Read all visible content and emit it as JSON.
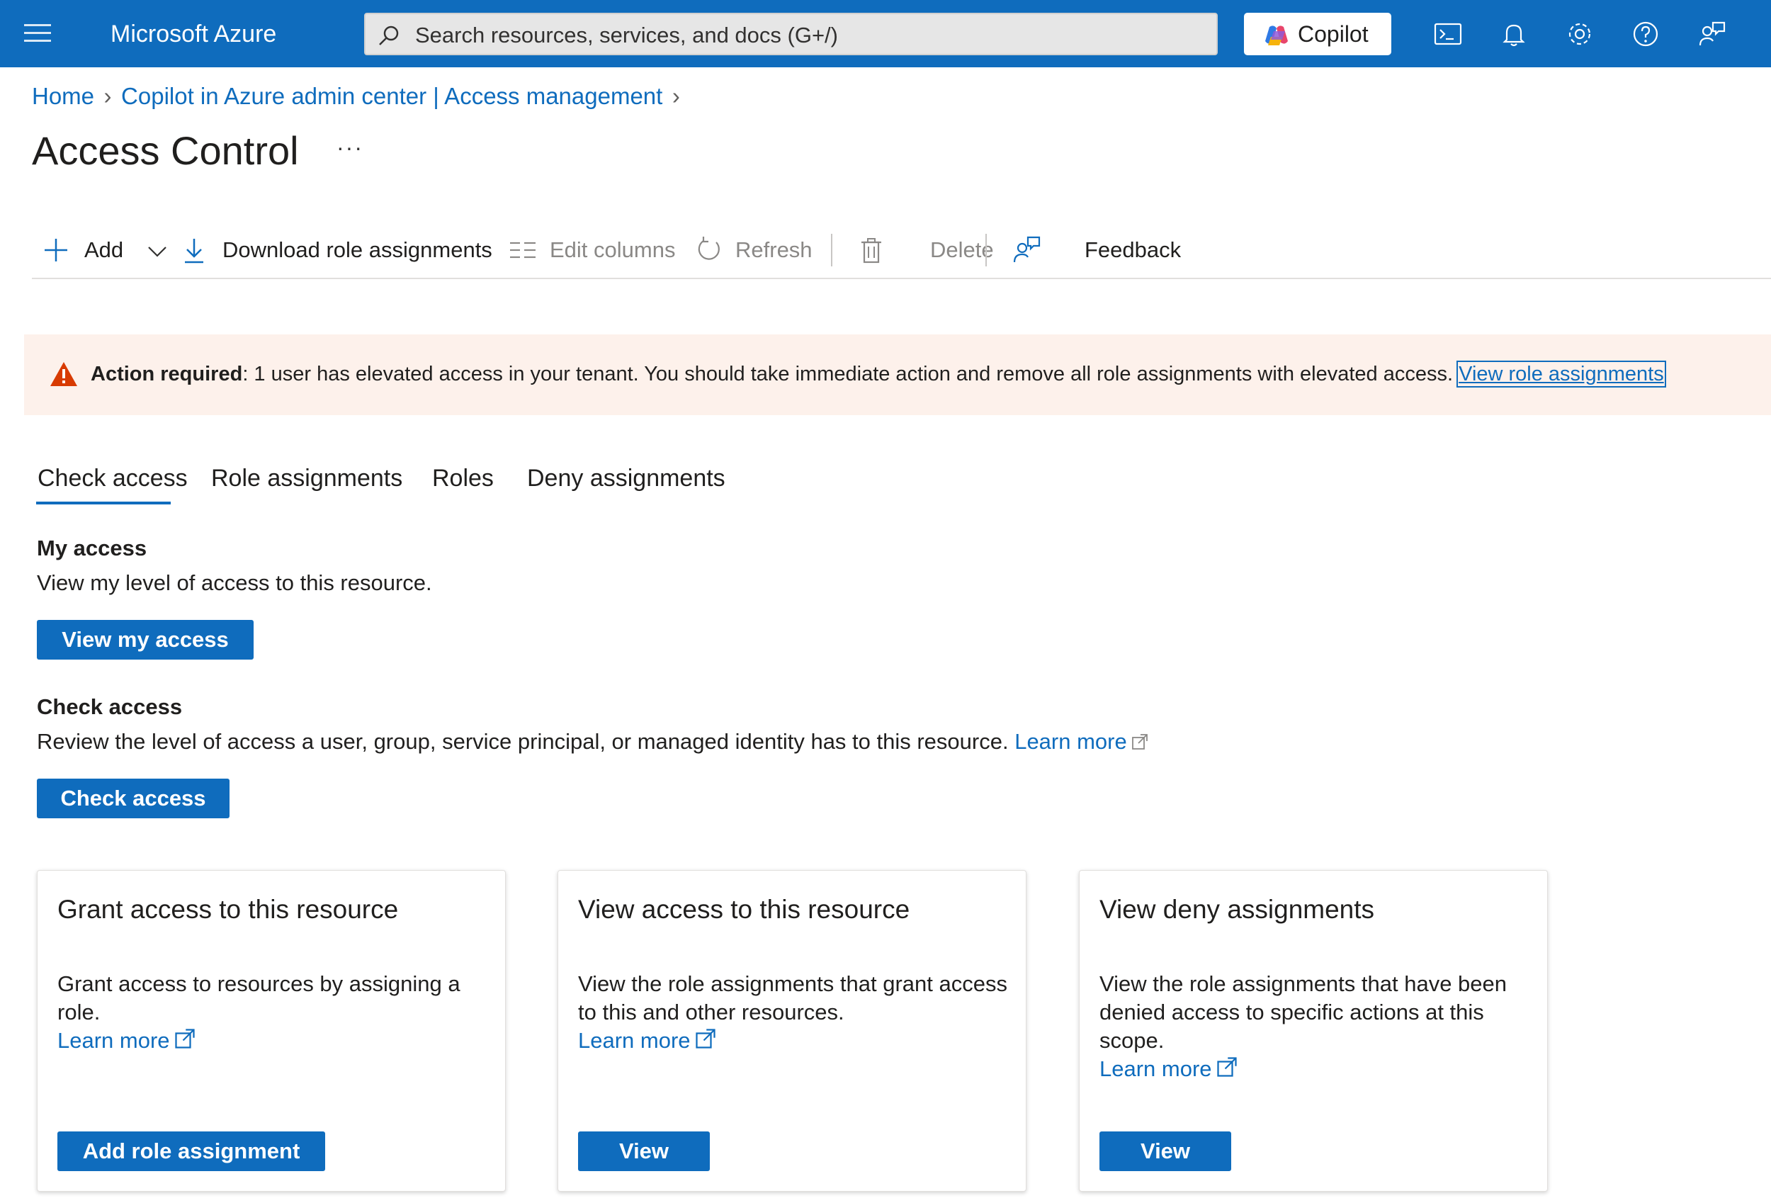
{
  "topbar": {
    "brand": "Microsoft Azure",
    "search_placeholder": "Search resources, services, and docs (G+/)",
    "copilot_label": "Copilot",
    "icons": [
      "cloud-shell-icon",
      "notifications-icon",
      "settings-icon",
      "help-icon",
      "feedback-icon"
    ]
  },
  "breadcrumb": {
    "home": "Home",
    "parent": "Copilot in Azure admin center | Access management"
  },
  "page": {
    "title": "Access Control",
    "more": "···"
  },
  "commands": {
    "add": "Add",
    "download": "Download role assignments",
    "edit_columns": "Edit columns",
    "refresh": "Refresh",
    "delete": "Delete",
    "feedback": "Feedback"
  },
  "alert": {
    "bold": "Action required",
    "text": ": 1 user has elevated access in your tenant. You should take immediate action and remove all role assignments with elevated access. ",
    "link": "View role assignments",
    "color": "#d83b01"
  },
  "tabs": [
    {
      "label": "Check access",
      "active": true
    },
    {
      "label": "Role assignments",
      "active": false
    },
    {
      "label": "Roles",
      "active": false
    },
    {
      "label": "Deny assignments",
      "active": false
    }
  ],
  "my_access": {
    "title": "My access",
    "description": "View my level of access to this resource.",
    "button": "View my access"
  },
  "check_access": {
    "title": "Check access",
    "description": "Review the level of access a user, group, service principal, or managed identity has to this resource. ",
    "learn_more": "Learn more",
    "button": "Check access"
  },
  "cards": [
    {
      "title": "Grant access to this resource",
      "description": "Grant access to resources by assigning a role.",
      "learn_more": "Learn more",
      "button": "Add role assignment"
    },
    {
      "title": "View access to this resource",
      "description": "View the role assignments that grant access to this and other resources.",
      "learn_more": "Learn more",
      "button": "View"
    },
    {
      "title": "View deny assignments",
      "description": "View the role assignments that have been denied access to specific actions at this scope.",
      "learn_more": "Learn more",
      "button": "View"
    }
  ],
  "colors": {
    "brand_blue": "#0f6cbd",
    "alert_bg": "#fdf1eb"
  }
}
